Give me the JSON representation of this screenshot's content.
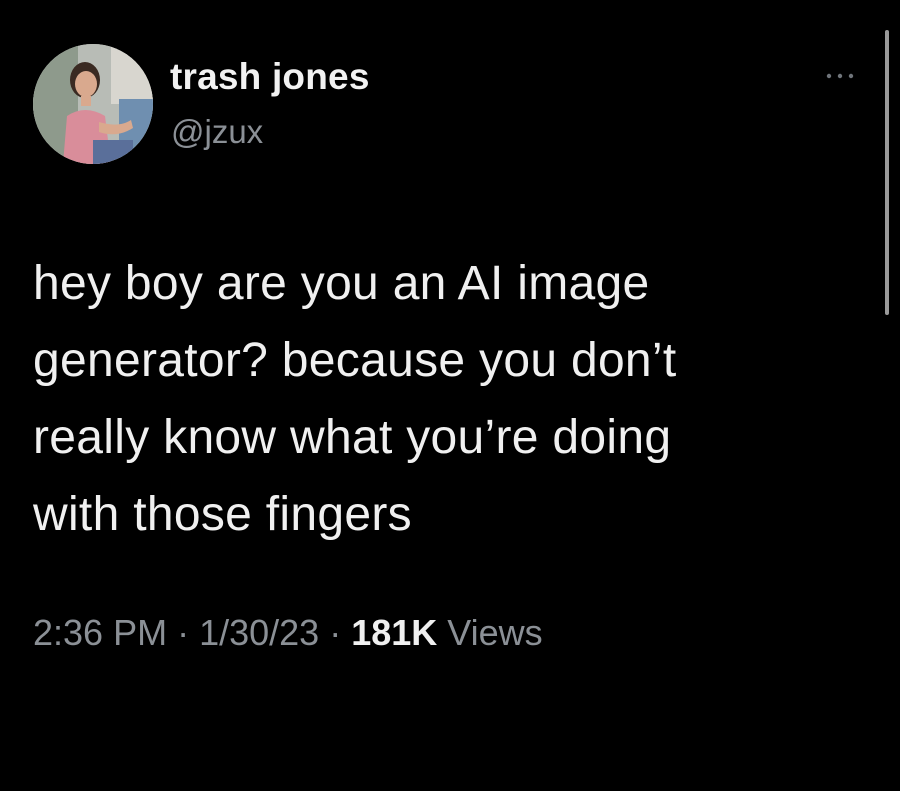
{
  "tweet": {
    "display_name": "trash jones",
    "handle": "@jzux",
    "avatar_icon": "profile-photo-avatar",
    "more_icon": "more-dots-icon",
    "text": "hey boy are you an AI image\ngenerator? because you don’t\nreally know what you’re doing\nwith those fingers",
    "time": "2:36 PM",
    "separator": " · ",
    "date": "1/30/23",
    "views_count": "181K",
    "views_label": " Views"
  },
  "colors": {
    "background": "#000000",
    "primary_text": "#f0f0f0",
    "secondary_text": "#8b9096"
  }
}
